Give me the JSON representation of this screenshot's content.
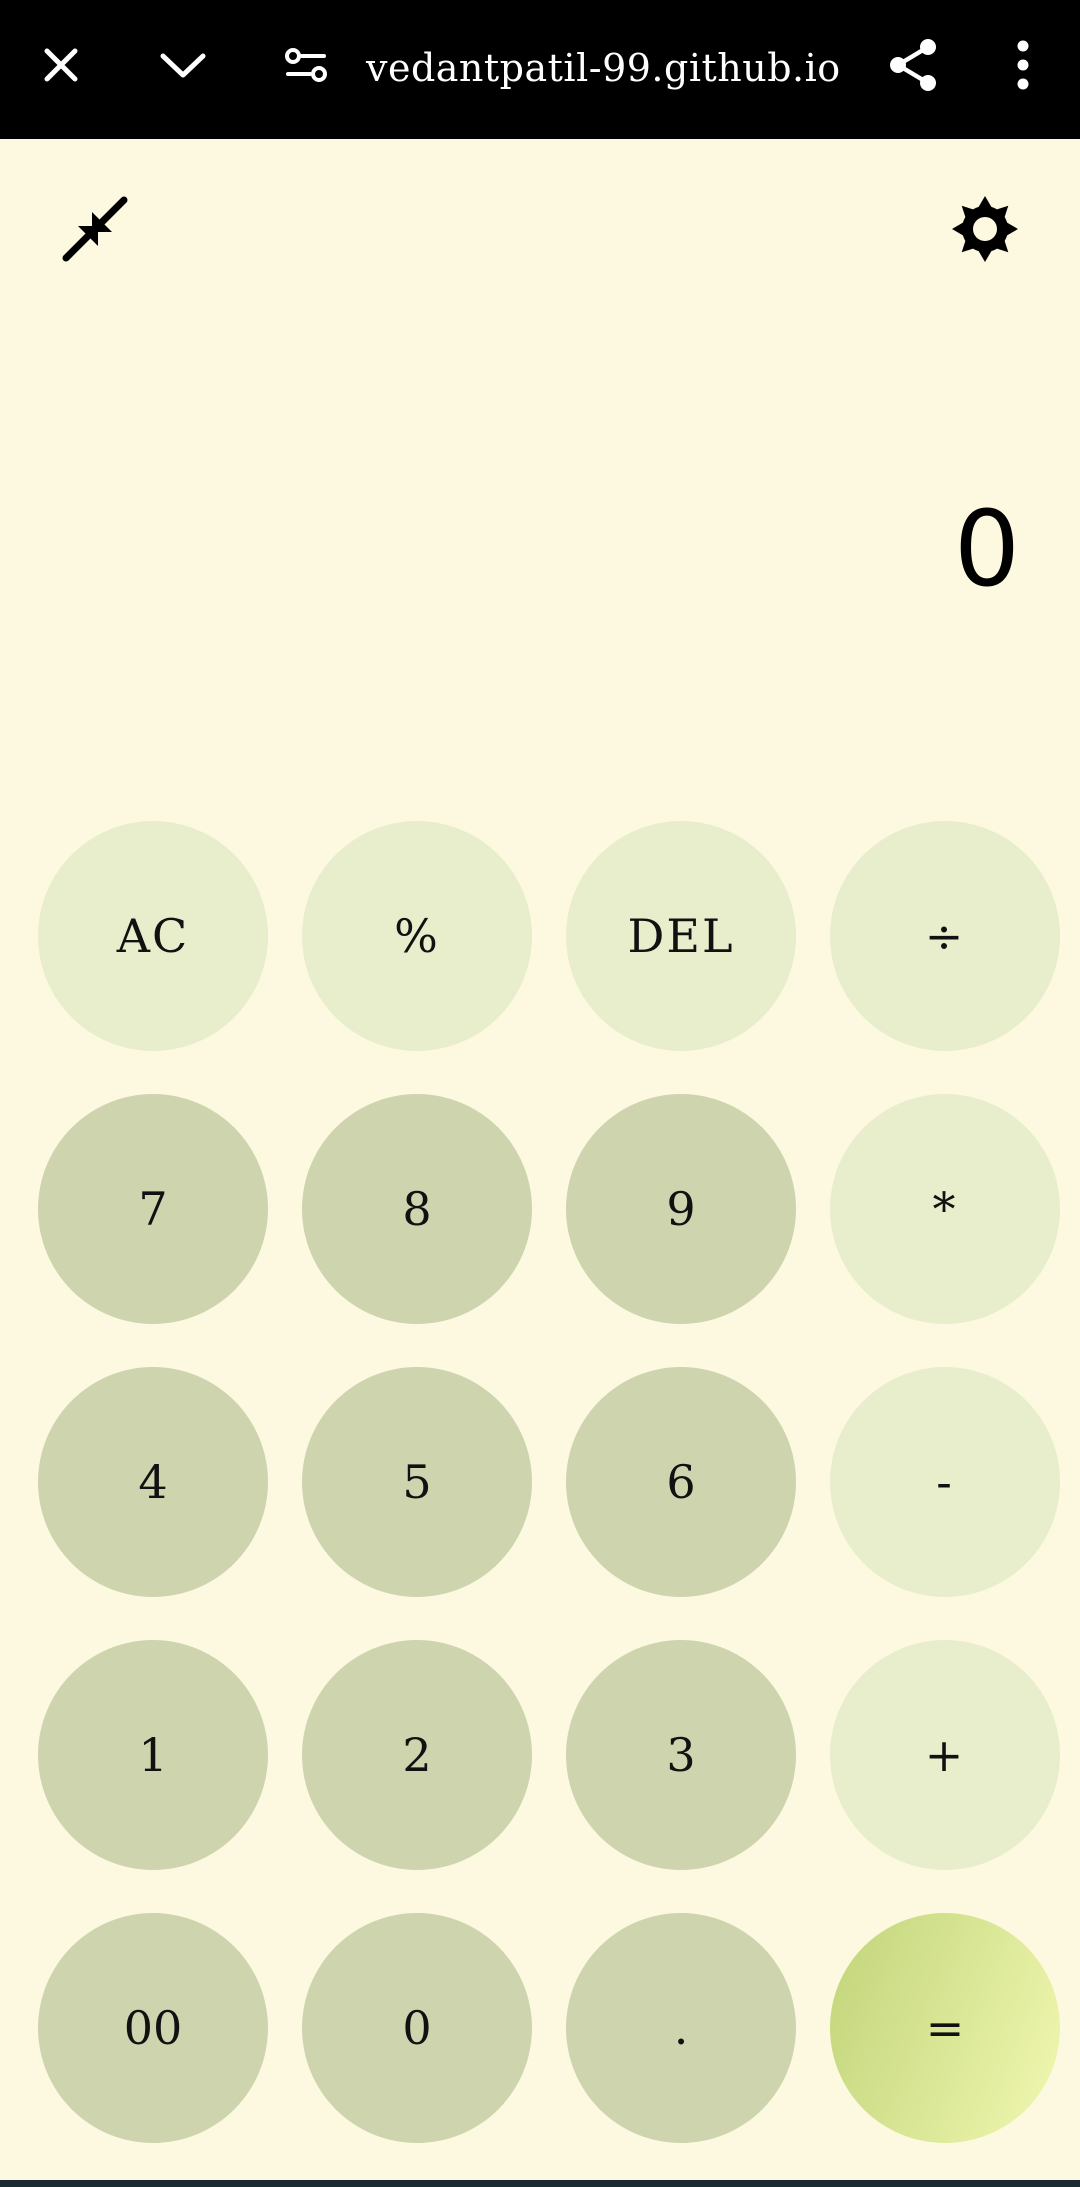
{
  "browser": {
    "url": "vedantpatil-99.github.io",
    "icons": {
      "close": "close-icon",
      "collapse": "chevron-down-icon",
      "site_settings": "tune-icon",
      "share": "share-icon",
      "menu": "more-vert-icon"
    }
  },
  "app": {
    "icons": {
      "minimize": "minimize-arrows-icon",
      "theme": "sun-gear-icon"
    },
    "display_value": "0",
    "keys": [
      [
        "AC",
        "%",
        "DEL",
        "÷"
      ],
      [
        "7",
        "8",
        "9",
        "*"
      ],
      [
        "4",
        "5",
        "6",
        "-"
      ],
      [
        "1",
        "2",
        "3",
        "+"
      ],
      [
        "00",
        "0",
        ".",
        "="
      ]
    ]
  },
  "colors": {
    "background": "#fdf9e1",
    "function_key": "#e8edcc",
    "number_key": "#cdd4ae",
    "equals_gradient_start": "#c1d47a",
    "equals_gradient_end": "#f1f8b1",
    "topbar": "#000000"
  }
}
